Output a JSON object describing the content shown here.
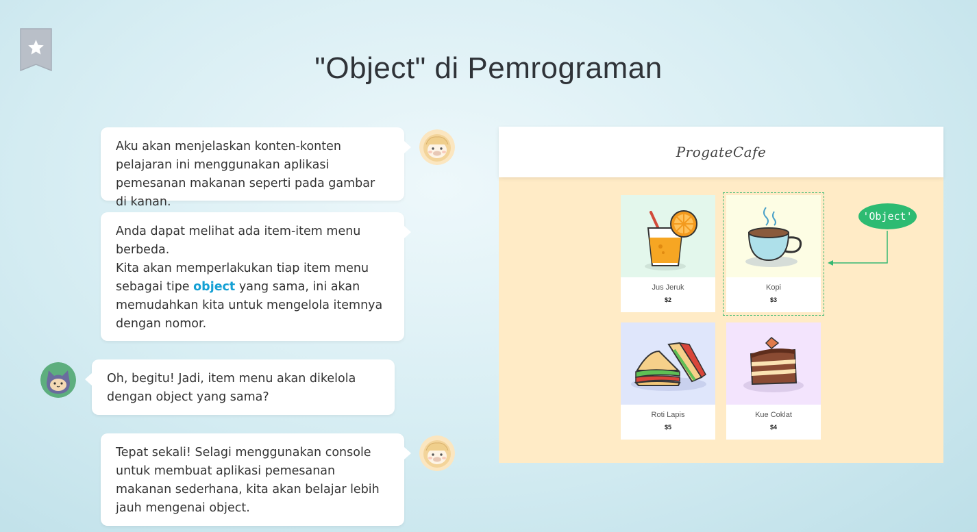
{
  "page": {
    "title": "\"Object\" di Pemrograman"
  },
  "icons": {
    "bookmark": "star-bookmark-icon"
  },
  "colors": {
    "keyword": "#14a0d4",
    "object_tag": "#2dbb72",
    "panel_bg": "#ffebc6"
  },
  "chat": {
    "msg1": "Aku akan menjelaskan konten-konten pelajaran ini menggunakan aplikasi pemesanan makanan seperti pada gambar di kanan.",
    "msg2_line1": "Anda dapat melihat ada item-item menu berbeda.",
    "msg2_pre": "Kita akan memperlakukan tiap item menu sebagai tipe ",
    "msg2_keyword": "object",
    "msg2_post": " yang sama, ini akan memudahkan kita untuk mengelola itemnya dengan nomor.",
    "msg3": "Oh, begitu! Jadi, item menu akan dikelola dengan object yang sama?",
    "msg4": "Tepat sekali! Selagi menggunakan console untuk membuat aplikasi pemesanan makanan sederhana, kita akan belajar lebih jauh mengenai object."
  },
  "cafe": {
    "logo": "ProgateCafe",
    "object_label": "'Object'",
    "items": [
      {
        "name": "Jus Jeruk",
        "price": "$2"
      },
      {
        "name": "Kopi",
        "price": "$3"
      },
      {
        "name": "Roti Lapis",
        "price": "$5"
      },
      {
        "name": "Kue Coklat",
        "price": "$4"
      }
    ]
  }
}
